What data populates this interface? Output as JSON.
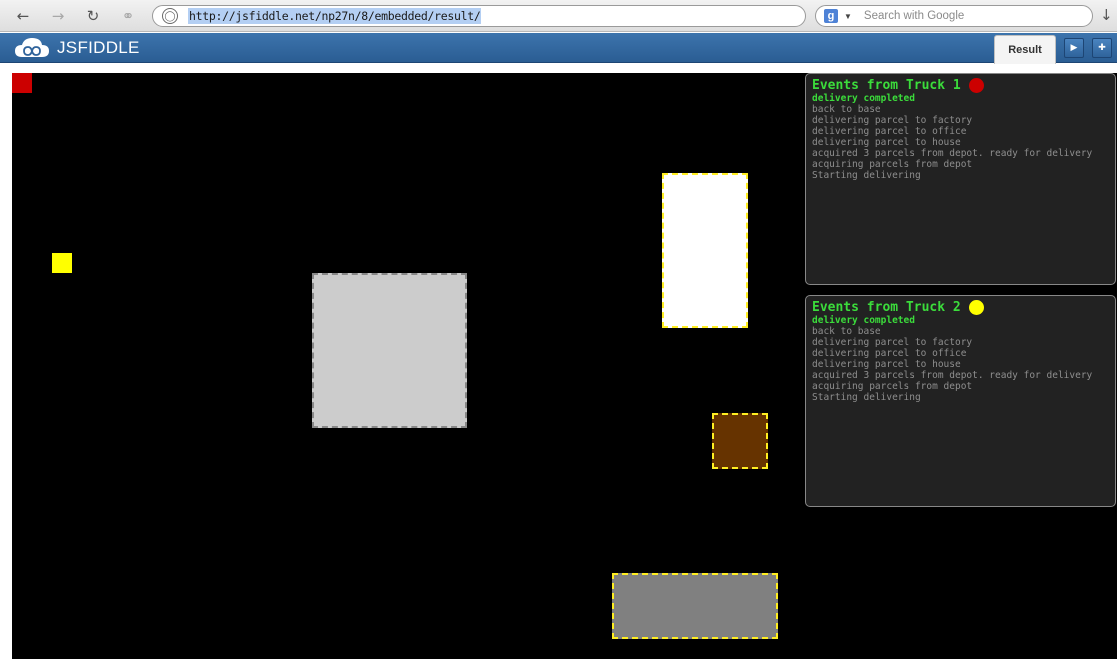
{
  "browser": {
    "url": "http://jsfiddle.net/np27n/8/embedded/result/",
    "search_placeholder": "Search with Google",
    "search_engine_letter": "g"
  },
  "fiddle": {
    "logo_text": "JSFIDDLE",
    "result_tab": "Result"
  },
  "colors": {
    "truck1": "#cc0000",
    "truck2": "#ffff00",
    "panel_title": "#3bdc3b",
    "zone_border": "#ffee22",
    "depot_fill": "#cccccc",
    "house_fill": "#ffffff",
    "office_fill": "#663300",
    "factory_fill": "#808080"
  },
  "panels": [
    {
      "title": "Events from Truck 1",
      "dot_color": "#cc0000",
      "latest": "delivery completed",
      "events": [
        "back to base",
        "delivering parcel to factory",
        "delivering parcel to office",
        "delivering parcel to house",
        "acquired 3 parcels from depot. ready for delivery",
        "acquiring parcels from depot",
        "Starting delivering"
      ]
    },
    {
      "title": "Events from Truck 2",
      "dot_color": "#ffff00",
      "latest": "delivery completed",
      "events": [
        "back to base",
        "delivering parcel to factory",
        "delivering parcel to office",
        "delivering parcel to house",
        "acquired 3 parcels from depot. ready for delivery",
        "acquiring parcels from depot",
        "Starting delivering"
      ]
    }
  ]
}
